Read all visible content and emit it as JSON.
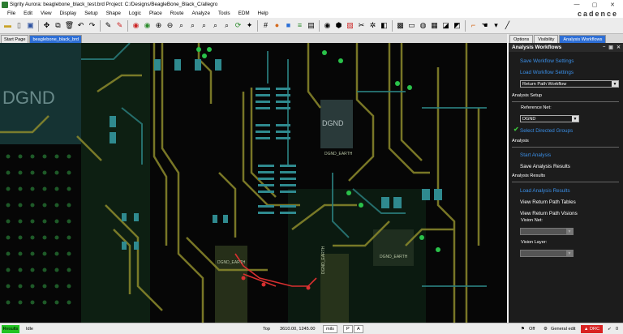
{
  "window": {
    "title": "Sigrity Aurora: beaglebone_black_test.brd  Project: C:/Designs/BeagleBone_Black_C/allegro",
    "controls": [
      "—",
      "▢",
      "✕"
    ]
  },
  "brand": "cadence",
  "menu": [
    "File",
    "Edit",
    "View",
    "Display",
    "Setup",
    "Shape",
    "Logic",
    "Place",
    "Route",
    "Analyze",
    "Tools",
    "EDM",
    "Help"
  ],
  "toolbar_icons": [
    "folder-open-icon",
    "new-file-icon",
    "save-icon",
    "cut-icon",
    "move-icon",
    "undo-icon",
    "delete-icon",
    "redo-icon",
    "undo-arrow-icon",
    "pin-icon",
    "fix-icon",
    "unfix-icon",
    "zoom-in-icon",
    "zoom-out-icon",
    "zoom-fit-icon",
    "zoom-prev-icon",
    "zoom-window-icon",
    "zoom-world-icon",
    "refresh-icon",
    "grid-icon",
    "color-icon",
    "layer-icon",
    "shadow-icon",
    "view-icon",
    "3d-icon",
    "select-icon",
    "measure-icon",
    "settings-icon",
    "text-icon",
    "capture-icon",
    "report-icon",
    "analyze-icon",
    "route-icon",
    "check-icon"
  ],
  "doc_tabs": [
    "Start Page",
    "beaglebone_black_brd"
  ],
  "panel_tabs": [
    "Options",
    "Visibility",
    "Analysis Workflows"
  ],
  "panel": {
    "title": "Analysis Workflows",
    "header_icons": [
      "–",
      "▣",
      "✕"
    ],
    "save_workflow": "Save Workflow Settings",
    "load_workflow": "Load Workflow Settings",
    "workflow_select": "Return Path Workflow",
    "section_setup": "Analysis Setup",
    "reference_net_label": "Reference Net:",
    "reference_net_value": "DGND",
    "select_groups": "Select Directed Groups",
    "section_analysis": "Analysis",
    "start_analysis": "Start Analysis",
    "save_results": "Save Analysis Results",
    "section_results": "Analysis Results",
    "load_results": "Load Analysis Results",
    "view_tables": "View Return Path Tables",
    "view_visions": "View Return Path Visions",
    "vision_net_label": "Vision Net:",
    "vision_layer_label": "Vision Layer:"
  },
  "canvas_labels": {
    "dgnd_big": "DGND",
    "dgnd_small": "DGND",
    "dgnd_earth_1": "DGND_EARTH",
    "dgnd_earth_2": "DGND_EARTH",
    "dgnd_earth_3": "DGND_EARTH",
    "dgnd_earth_4": "DGND_EARTH"
  },
  "status": {
    "results": "Results",
    "state": "Idle",
    "layer": "Top",
    "coords": "3610.00, 1245.00",
    "units": "mils",
    "p_btn": "P",
    "a_btn": "A",
    "off": "Off",
    "mode": "General edit",
    "drc": "DRC",
    "count": "0"
  },
  "colors": {
    "accent": "#2e6fd6",
    "link": "#3a8fe8",
    "results_green": "#22c322",
    "drc_red": "#d92222"
  }
}
